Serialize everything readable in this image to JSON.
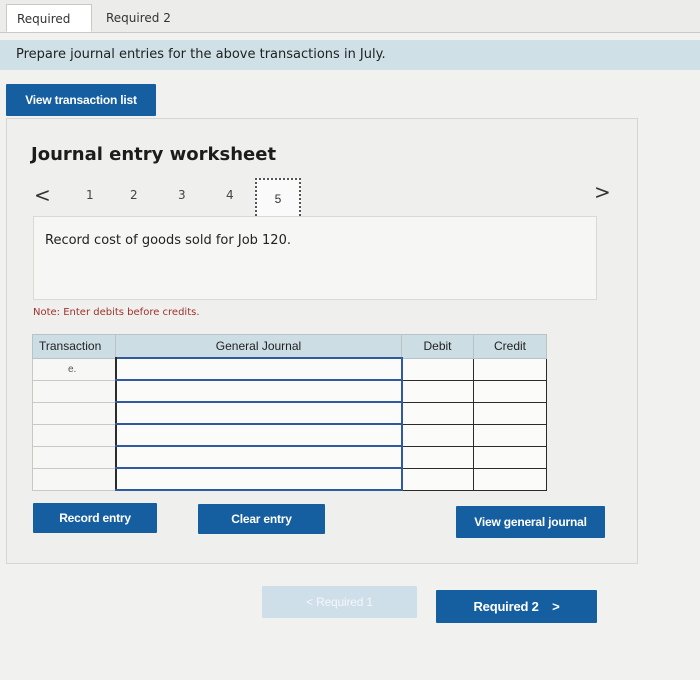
{
  "tabs": [
    {
      "label": "Required 1"
    },
    {
      "label": "Required 2"
    }
  ],
  "instruction": "Prepare journal entries for the above transactions in July.",
  "buttons": {
    "view_transaction_list": "View transaction list",
    "record_entry": "Record entry",
    "clear_entry": "Clear entry",
    "view_general_journal": "View general journal"
  },
  "worksheet": {
    "title": "Journal entry worksheet",
    "pages": [
      "1",
      "2",
      "3",
      "4",
      "5"
    ],
    "current_page": "5",
    "prev_icon": "<",
    "next_icon": ">",
    "description": "Record cost of goods sold for Job 120.",
    "note": "Note: Enter debits before credits."
  },
  "journal_table": {
    "headers": [
      "Transaction",
      "General Journal",
      "Debit",
      "Credit"
    ],
    "rows": [
      {
        "transaction": "e.",
        "account": "",
        "debit": "",
        "credit": ""
      },
      {
        "transaction": "",
        "account": "",
        "debit": "",
        "credit": ""
      },
      {
        "transaction": "",
        "account": "",
        "debit": "",
        "credit": ""
      },
      {
        "transaction": "",
        "account": "",
        "debit": "",
        "credit": ""
      },
      {
        "transaction": "",
        "account": "",
        "debit": "",
        "credit": ""
      },
      {
        "transaction": "",
        "account": "",
        "debit": "",
        "credit": ""
      }
    ]
  },
  "nav": {
    "prev_label": "< Required 1",
    "next_label": "Required 2",
    "next_icon": ">"
  },
  "colors": {
    "button_blue": "#155fa0",
    "header_bar": "#cfe0e6",
    "note_red": "#a0322a",
    "disabled_button": "#cfdfea"
  }
}
